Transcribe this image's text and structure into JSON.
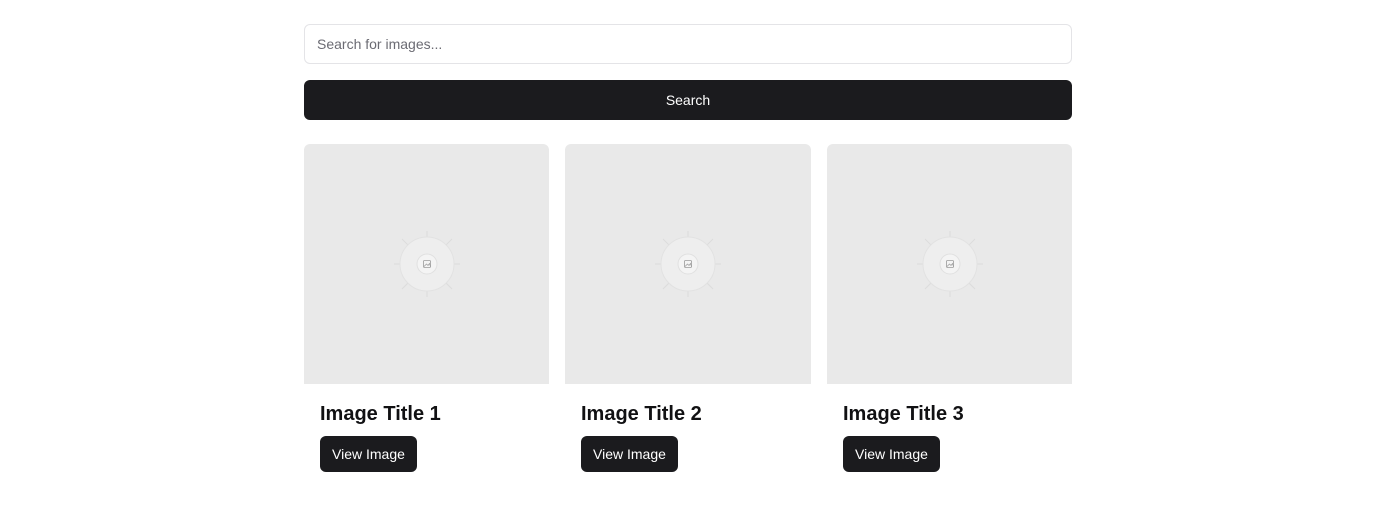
{
  "search": {
    "placeholder": "Search for images...",
    "value": "",
    "button_label": "Search"
  },
  "cards": [
    {
      "title": "Image Title 1",
      "button_label": "View Image",
      "icon": "image-placeholder-icon"
    },
    {
      "title": "Image Title 2",
      "button_label": "View Image",
      "icon": "image-placeholder-icon"
    },
    {
      "title": "Image Title 3",
      "button_label": "View Image",
      "icon": "image-placeholder-icon"
    }
  ],
  "colors": {
    "primary": "#1b1b1e",
    "placeholder_bg": "#e9e9e9",
    "border": "#e4e4e7"
  }
}
